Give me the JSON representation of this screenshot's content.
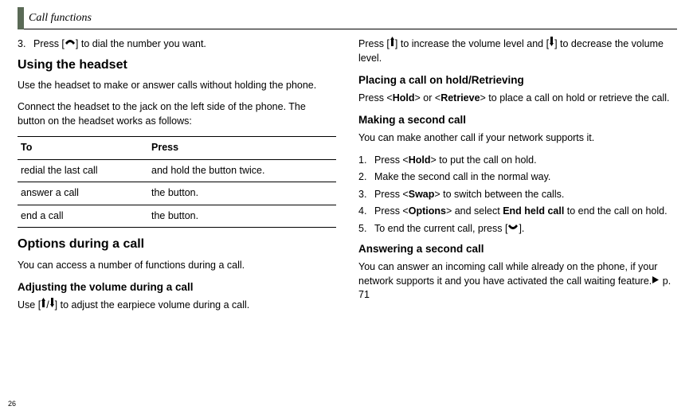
{
  "header": {
    "title": "Call functions"
  },
  "page_number": "26",
  "left": {
    "step3_prefix": "3.",
    "step3_a": "Press [",
    "step3_b": "] to dial the number you want.",
    "h2_headset": "Using the headset",
    "headset_p1": "Use the headset to make or answer calls without holding the phone.",
    "headset_p2": "Connect the headset to the jack on the left side of the phone. The button on the headset works as follows:",
    "table": {
      "head": {
        "c1": "To",
        "c2": "Press"
      },
      "rows": [
        {
          "c1": "redial the last call",
          "c2": "and hold the button twice."
        },
        {
          "c1": "answer a call",
          "c2": "the button."
        },
        {
          "c1": "end a call",
          "c2": "the button."
        }
      ]
    },
    "h2_options": "Options during a call",
    "options_p": "You can access a number of functions during a call.",
    "h3_volume": "Adjusting the volume during a call",
    "vol_a": "Use [",
    "vol_mid": "/",
    "vol_b": "] to adjust the earpiece volume during a call."
  },
  "right": {
    "vol2_a": "Press [",
    "vol2_b": "] to increase the volume level and [",
    "vol2_c": "] to decrease the volume level.",
    "h3_hold": "Placing a call on hold/Retrieving",
    "hold_a": "Press <",
    "hold_b": "Hold",
    "hold_c": "> or <",
    "hold_d": "Retrieve",
    "hold_e": "> to place a call on hold or retrieve the call.",
    "h3_second": "Making a second call",
    "second_intro": "You can make another call if your network supports it.",
    "s1_n": "1.",
    "s1_a": "Press <",
    "s1_b": "Hold",
    "s1_c": "> to put the call on hold.",
    "s2_n": "2.",
    "s2": "Make the second call in the normal way.",
    "s3_n": "3.",
    "s3_a": "Press <",
    "s3_b": "Swap",
    "s3_c": "> to switch between the calls.",
    "s4_n": "4.",
    "s4_a": "Press <",
    "s4_b": "Options",
    "s4_c": "> and select ",
    "s4_d": "End held call",
    "s4_e": " to end the call on hold.",
    "s5_n": "5.",
    "s5_a": "To end the current call, press [",
    "s5_b": "].",
    "h3_answer": "Answering a second call",
    "ans_a": "You can answer an incoming call while already on the phone, if your network supports it and you have activated the call waiting feature.",
    "ans_b": "p. 71"
  },
  "icons": {
    "dial": "dial-icon",
    "vol_up": "volume-up-icon",
    "vol_down": "volume-down-icon",
    "end_call": "end-call-icon",
    "triangle": "triangle-right-icon"
  }
}
